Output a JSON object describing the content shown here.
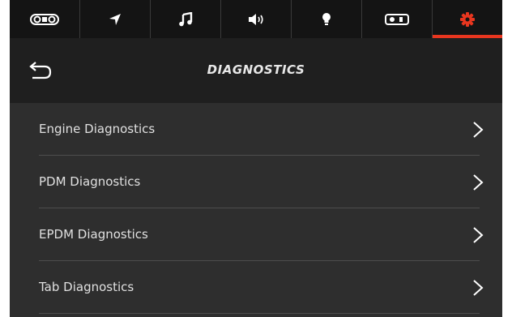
{
  "tabbar": {
    "tabs": [
      {
        "icon": "vehicle-icon",
        "active": false
      },
      {
        "icon": "navigation-icon",
        "active": false
      },
      {
        "icon": "music-icon",
        "active": false
      },
      {
        "icon": "volume-icon",
        "active": false
      },
      {
        "icon": "light-bulb-icon",
        "active": false
      },
      {
        "icon": "switch-icon",
        "active": false
      },
      {
        "icon": "settings-gear-icon",
        "active": true
      }
    ],
    "active_color": "#e8361f"
  },
  "header": {
    "back_icon": "back-arrow-icon",
    "title": "DIAGNOSTICS"
  },
  "menu": {
    "items": [
      {
        "label": "Engine Diagnostics",
        "icon": "chevron-right-icon"
      },
      {
        "label": "PDM Diagnostics",
        "icon": "chevron-right-icon"
      },
      {
        "label": "EPDM Diagnostics",
        "icon": "chevron-right-icon"
      },
      {
        "label": "Tab Diagnostics",
        "icon": "chevron-right-icon"
      }
    ]
  }
}
